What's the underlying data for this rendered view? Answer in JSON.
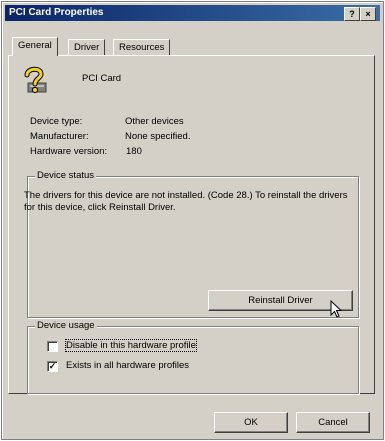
{
  "window": {
    "title": "PCI Card Properties",
    "help_label": "?",
    "close_label": "×"
  },
  "tabs": [
    {
      "label": "General",
      "active": true
    },
    {
      "label": "Driver",
      "active": false
    },
    {
      "label": "Resources",
      "active": false
    }
  ],
  "device": {
    "icon": "question-mark-device-icon",
    "name": "PCI Card"
  },
  "properties": [
    {
      "label": "Device type:",
      "value": "Other devices"
    },
    {
      "label": "Manufacturer:",
      "value": "None specified."
    },
    {
      "label": "Hardware version:",
      "value": "180"
    }
  ],
  "device_status": {
    "title": "Device status",
    "text": "The drivers for this device are not installed. (Code 28.) To reinstall the drivers for this device, click Reinstall Driver.",
    "reinstall_label": "Reinstall Driver"
  },
  "device_usage": {
    "title": "Device usage",
    "options": [
      {
        "label": "Disable in this hardware profile",
        "checked": false,
        "check_glyph": ""
      },
      {
        "label": "Exists in all hardware profiles",
        "checked": true,
        "check_glyph": "✓"
      }
    ]
  },
  "buttons": {
    "ok_label": "OK",
    "cancel_label": "Cancel"
  },
  "colors": {
    "titlebar_start": "#0a246a",
    "titlebar_end": "#3a6ea5",
    "face": "#d4d0c8"
  }
}
